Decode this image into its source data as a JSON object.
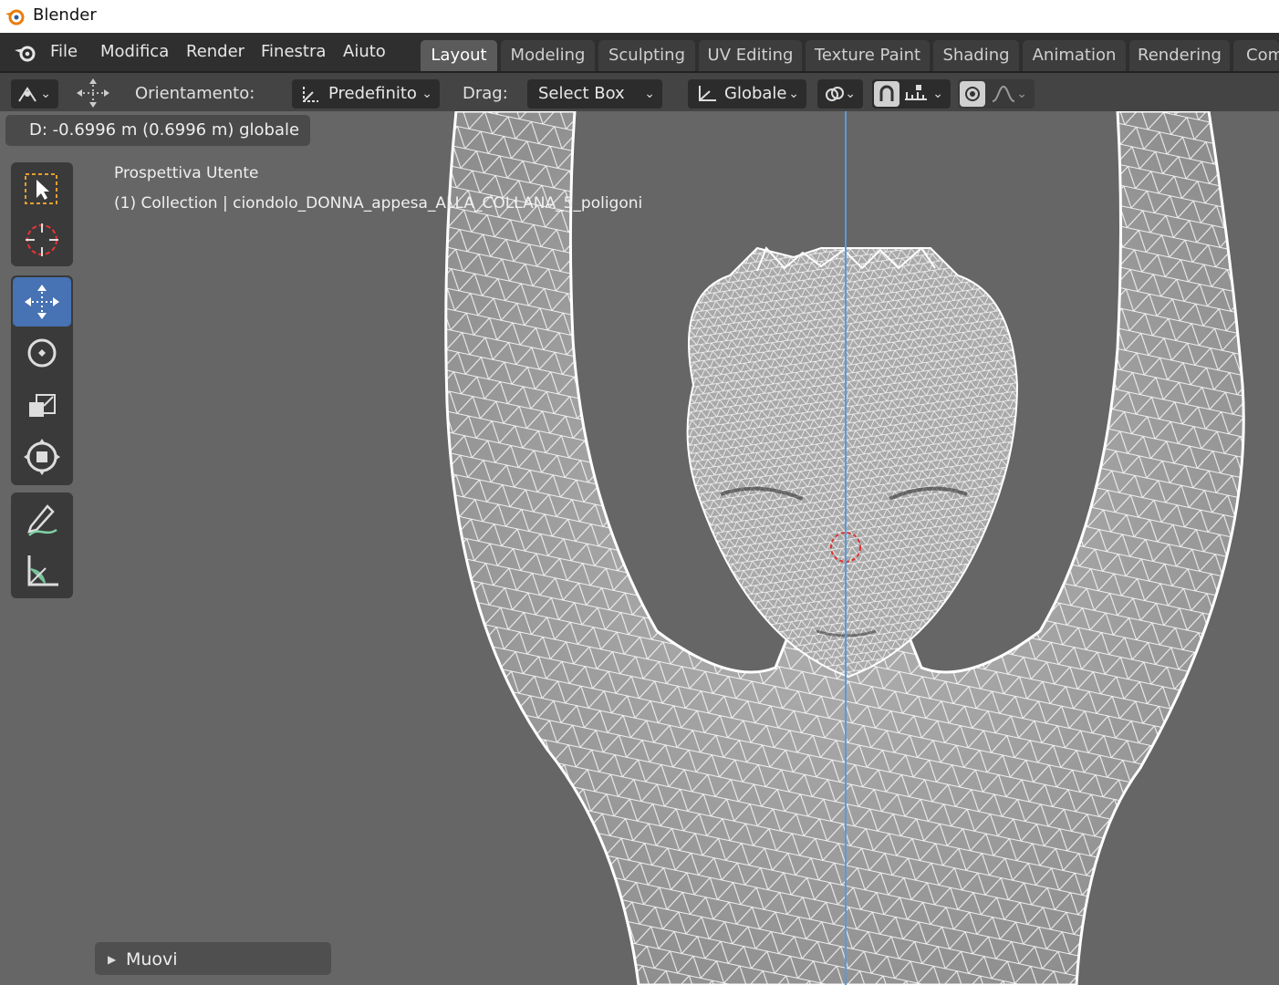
{
  "window": {
    "title": "Blender"
  },
  "menu": {
    "items": [
      "File",
      "Modifica",
      "Render",
      "Finestra",
      "Aiuto"
    ]
  },
  "workspaces": {
    "tabs": [
      "Layout",
      "Modeling",
      "Sculpting",
      "UV Editing",
      "Texture Paint",
      "Shading",
      "Animation",
      "Rendering",
      "Com"
    ],
    "active": "Layout"
  },
  "header": {
    "orientation_label": "Orientamento:",
    "orientation_value": "Predefinito",
    "drag_label": "Drag:",
    "drag_value": "Select Box",
    "transform_value": "Globale"
  },
  "viewport": {
    "operator_status": "D: -0.6996 m (0.6996 m) globale",
    "view_name": "Prospettiva Utente",
    "collection_info": "(1) Collection | ciondolo_DONNA_appesa_ALLA_COLLANA_5_poligoni"
  },
  "toolbar": {
    "tools": [
      "select-box",
      "cursor",
      "move",
      "rotate",
      "scale",
      "transform",
      "annotate",
      "measure"
    ],
    "active": "move"
  },
  "operator_panel": {
    "label": "Muovi"
  },
  "colors": {
    "active_blue": "#4772b3",
    "axis_line": "#5a9bd8",
    "viewport_bg": "#666666"
  }
}
